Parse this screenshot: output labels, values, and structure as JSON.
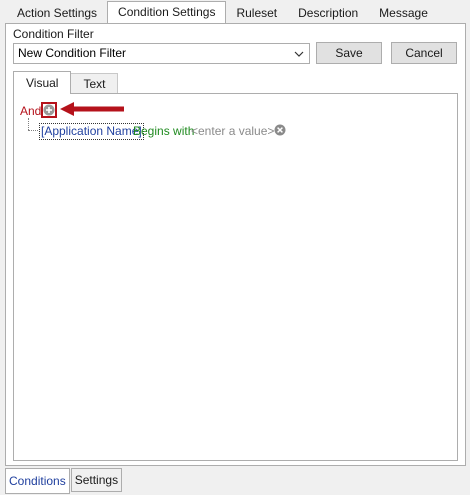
{
  "top_tabs": [
    {
      "label": "Action Settings"
    },
    {
      "label": "Condition Settings"
    },
    {
      "label": "Ruleset"
    },
    {
      "label": "Description"
    },
    {
      "label": "Message"
    }
  ],
  "condition_filter": {
    "label": "Condition Filter",
    "selected": "New Condition Filter",
    "save_label": "Save",
    "cancel_label": "Cancel"
  },
  "inner_tabs": [
    {
      "label": "Visual"
    },
    {
      "label": "Text"
    }
  ],
  "tree": {
    "group_operator": "And",
    "condition": {
      "field": "[Application Name]",
      "operator": "Begins with",
      "value_placeholder": "<enter a value>"
    }
  },
  "bottom_tabs": [
    {
      "label": "Conditions"
    },
    {
      "label": "Settings"
    }
  ],
  "colors": {
    "group_operator": "#b5121b",
    "field": "#1f3f9e",
    "operator": "#1f8a1f",
    "placeholder": "#8a8a8a",
    "annotation_arrow": "#b5121b"
  }
}
